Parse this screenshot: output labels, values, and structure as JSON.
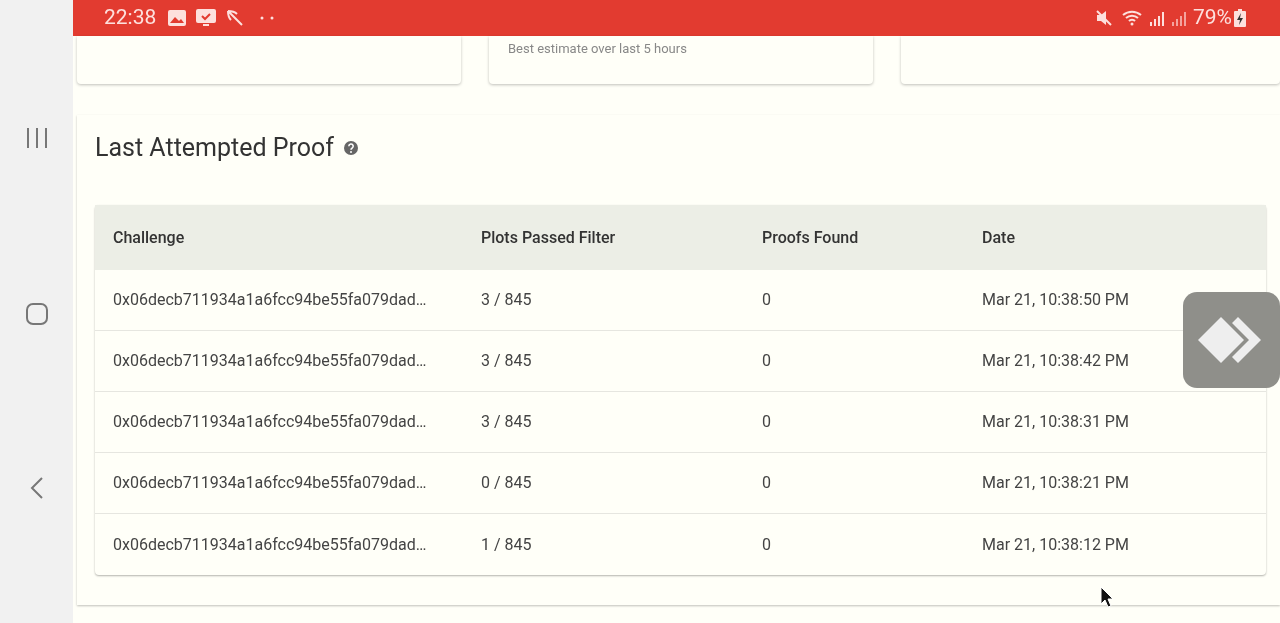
{
  "status_bar": {
    "time": "22:38",
    "battery": "79%"
  },
  "estimate_card": {
    "caption": "Best estimate over last 5 hours"
  },
  "section": {
    "title": "Last Attempted Proof"
  },
  "table": {
    "columns": [
      "Challenge",
      "Plots Passed Filter",
      "Proofs Found",
      "Date"
    ],
    "rows": [
      [
        "0x06decb711934a1a6fcc94be55fa079dad…",
        "3 / 845",
        "0",
        "Mar 21, 10:38:50 PM"
      ],
      [
        "0x06decb711934a1a6fcc94be55fa079dad…",
        "3 / 845",
        "0",
        "Mar 21, 10:38:42 PM"
      ],
      [
        "0x06decb711934a1a6fcc94be55fa079dad…",
        "3 / 845",
        "0",
        "Mar 21, 10:38:31 PM"
      ],
      [
        "0x06decb711934a1a6fcc94be55fa079dad…",
        "0 / 845",
        "0",
        "Mar 21, 10:38:21 PM"
      ],
      [
        "0x06decb711934a1a6fcc94be55fa079dad…",
        "1 / 845",
        "0",
        "Mar 21, 10:38:12 PM"
      ]
    ]
  }
}
